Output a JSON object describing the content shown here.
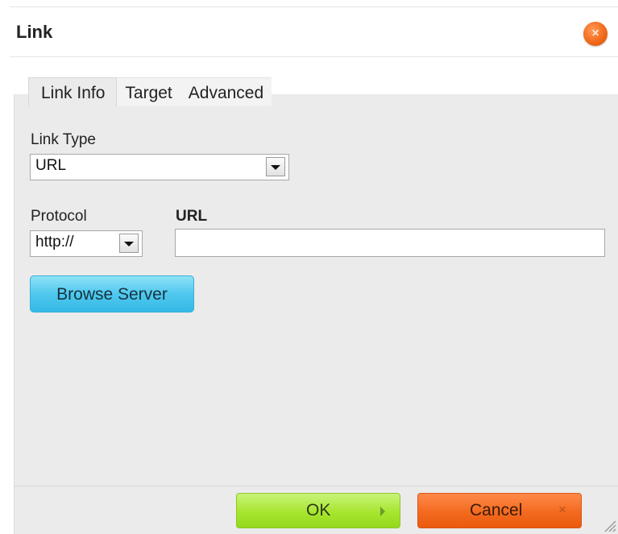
{
  "dialog": {
    "title": "Link",
    "close_icon": "×"
  },
  "tabs": [
    {
      "label": "Link Info",
      "active": true
    },
    {
      "label": "Target",
      "active": false
    },
    {
      "label": "Advanced",
      "active": false
    }
  ],
  "link_type": {
    "label": "Link Type",
    "value": "URL"
  },
  "protocol": {
    "label": "Protocol",
    "value": "http://"
  },
  "url": {
    "label": "URL",
    "value": "",
    "placeholder": ""
  },
  "browse_server": {
    "label": "Browse Server"
  },
  "footer": {
    "ok_label": "OK",
    "cancel_label": "Cancel",
    "cancel_icon": "×"
  },
  "colors": {
    "close": "#f26a1b",
    "ok": "#a7e62f",
    "cancel": "#f36a1f",
    "browse": "#4fc8ee",
    "panel": "#ebebeb"
  },
  "icons": {
    "close": "close-icon",
    "dropdown": "chevron-down-icon",
    "ok": "play-arrow-icon",
    "cancel": "x-icon",
    "resize": "resize-grip-icon"
  }
}
